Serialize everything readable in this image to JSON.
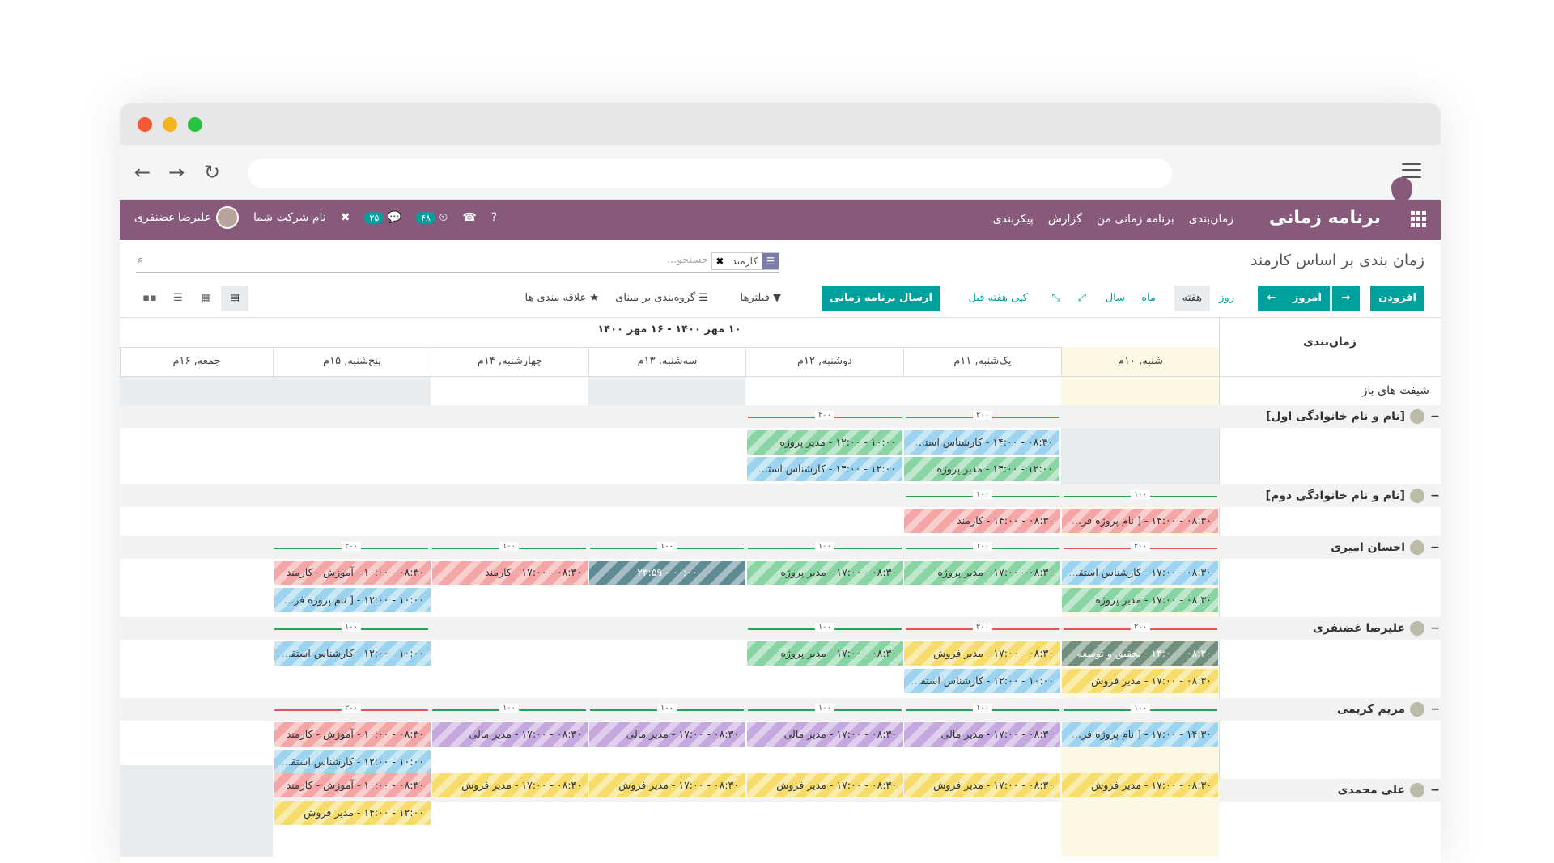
{
  "nav": {
    "brand": "برنامه زمانی",
    "menu": [
      "زمان‌بندی",
      "برنامه زمانی من",
      "گزارش",
      "پیکربندی"
    ],
    "company": "نام شرکت شما",
    "user": "علیرضا غضنفری",
    "badge_activity": "۳۵",
    "badge_timer": "۴۸"
  },
  "cp": {
    "breadcrumb": "زمان بندی بر اساس کارمند",
    "facet_label": "کارمند",
    "search_placeholder": "جستجو...",
    "add": "افزودن",
    "today": "امروز",
    "send": "ارسال برنامه زمانی",
    "copy_prev": "کپی هفته قبل",
    "scales": [
      "روز",
      "هفته",
      "ماه",
      "سال"
    ],
    "filters": "فیلترها",
    "groupby": "گروه‌بندی بر مبنای",
    "favorites": "علاقه مندی ها"
  },
  "gantt": {
    "title": "زمان‌بندی",
    "range": "۱۰ مهر ۱۴۰۰ - ۱۶ مهر ۱۴۰۰",
    "days": [
      "شنبه, ۱۰م",
      "یک‌شنبه, ۱۱م",
      "دوشنبه, ۱۲م",
      "سه‌شنبه, ۱۳م",
      "چهارشنبه, ۱۴م",
      "پنج‌شنبه, ۱۵م",
      "جمعه, ۱۶م"
    ],
    "open_shifts": "شیفت های باز",
    "rows": [
      {
        "name": "[نام و نام خانوادگی اول]",
        "sign": "−"
      },
      {
        "name": "[نام و نام خانوادگی دوم]",
        "sign": "−"
      },
      {
        "name": "احسان امیری",
        "sign": "−"
      },
      {
        "name": "علیرضا غضنفری",
        "sign": "−"
      },
      {
        "name": "مریم کریمی",
        "sign": "−"
      },
      {
        "name": "علی محمدی",
        "sign": "−"
      }
    ],
    "caps": {
      "c100": "۱۰۰",
      "c200": "۲۰۰"
    },
    "pills": {
      "p1": "۰۸:۳۰ - ۱۴:۰۰ - کارشناس استقرار...",
      "p2": "۱۰:۰۰ - ۱۲:۰۰ - مدیر پروژه",
      "p3": "۱۲:۰۰ - ۱۴:۰۰ - مدیر پروژه",
      "p4": "۱۲:۰۰ - ۱۴:۰۰ - کارشناس استقرار ...",
      "p5": "۰۸:۳۰ - ۱۴:۰۰ - [ نام پروژه فرضـ...",
      "p6": "۰۸:۳۰ - ۱۴:۰۰ - کارمند",
      "p7": "۰۸:۳۰ - ۱۷:۰۰ - کارشناس استقرار...",
      "p8": "۰۸:۳۰ - ۱۷:۰۰ - مدیر پروژه",
      "p9": "۰۸:۳۰ - ۱۷:۰۰ - مدیر پروژه",
      "p10": "۰۸:۳۰ - ۱۷:۰۰ - مدیر پروژه",
      "p11": "۰۰:۰۰ - ۲۳:۵۹",
      "p12": "۰۸:۳۰ - ۱۷:۰۰ - کارمند",
      "p13": "۰۸:۳۰ - ۱۰:۰۰ - آموزش - کارمند",
      "p14": "۱۰:۰۰ - ۱۲:۰۰ - [ نام پروژه فرضی ...",
      "p15": "۰۸:۳۰ - ۱۷:۰۰ - مدیر پروژه",
      "p16": "۰۸:۳۰ - ۱۴:۰۰ - تحقیق و توسعه",
      "p17": "۰۸:۳۰ - ۱۷:۰۰ - مدیر فروش",
      "p18": "۰۸:۳۰ - ۱۷:۰۰ - مدیر فروش",
      "p19": "۱۰:۰۰ - ۱۲:۰۰ - کارشناس استقرار ...",
      "p20": "۰۸:۳۰ - ۱۷:۰۰ - مدیر پروژه",
      "p21": "۱۰:۰۰ - ۱۲:۰۰ - کارشناس استقرار ...",
      "p22": "۱۴:۳۰ - ۱۷:۰۰ - [ نام پروژه فرضی...",
      "p23": "۰۸:۳۰ - ۱۷:۰۰ - مدیر مالی",
      "p24": "۰۸:۳۰ - ۱۷:۰۰ - مدیر مالی",
      "p25": "۰۸:۳۰ - ۱۷:۰۰ - مدیر مالی",
      "p26": "۰۸:۳۰ - ۱۷:۰۰ - مدیر مالی",
      "p27": "۰۸:۳۰ - ۱۰:۰۰ - آموزش - کارمند",
      "p28": "۱۰:۰۰ - ۱۲:۰۰ - کارشناس استقرار ...",
      "p29": "۰۸:۳۰ - ۱۷:۰۰ - مدیر فروش",
      "p30": "۰۸:۳۰ - ۱۷:۰۰ - مدیر فروش",
      "p31": "۰۸:۳۰ - ۱۷:۰۰ - مدیر فروش",
      "p32": "۰۸:۳۰ - ۱۷:۰۰ - مدیر فروش",
      "p33": "۰۸:۳۰ - ۱۷:۰۰ - مدیر فروش",
      "p34": "۰۸:۳۰ - ۱۰:۰۰ - آموزش - کارمند",
      "p35": "۱۲:۰۰ - ۱۴:۰۰ - مدیر فروش"
    }
  }
}
